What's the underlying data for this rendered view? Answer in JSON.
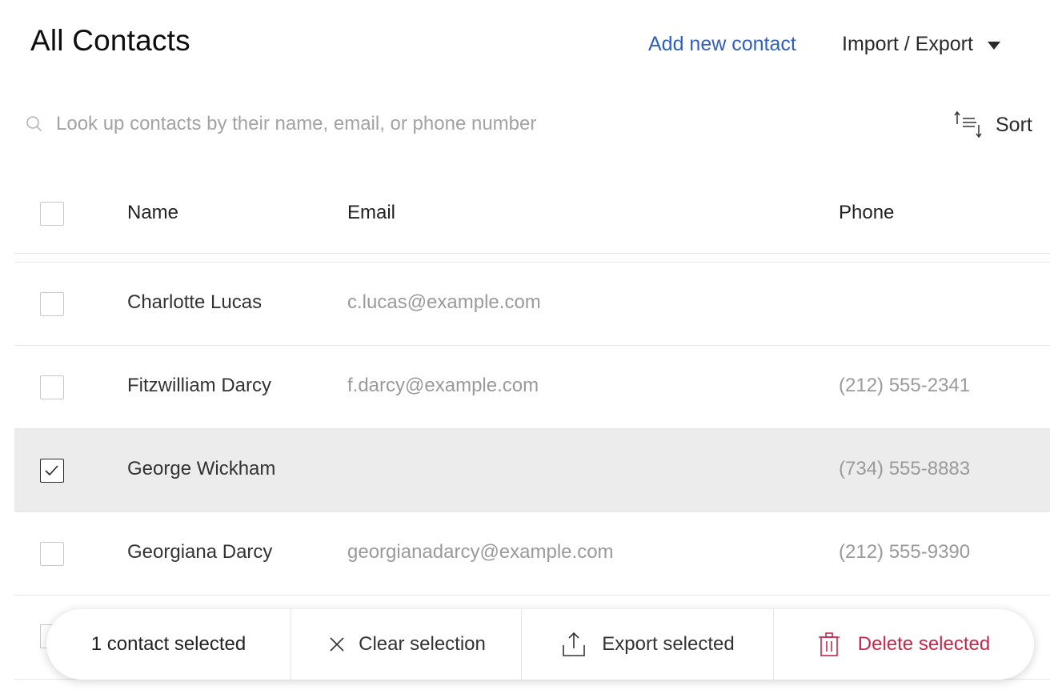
{
  "header": {
    "title": "All Contacts",
    "add_contact_label": "Add new contact",
    "import_export_label": "Import / Export"
  },
  "search": {
    "placeholder": "Look up contacts by their name, email, or phone number",
    "value": ""
  },
  "sort": {
    "label": "Sort"
  },
  "table": {
    "columns": [
      "Name",
      "Email",
      "Phone"
    ],
    "rows": [
      {
        "name": "Charlotte Lucas",
        "email": "c.lucas@example.com",
        "phone": "",
        "selected": false
      },
      {
        "name": "Fitzwilliam Darcy",
        "email": "f.darcy@example.com",
        "phone": "(212) 555-2341",
        "selected": false
      },
      {
        "name": "George Wickham",
        "email": "",
        "phone": "(734) 555-8883",
        "selected": true
      },
      {
        "name": "Georgiana Darcy",
        "email": "georgianadarcy@example.com",
        "phone": "(212) 555-9390",
        "selected": false
      }
    ]
  },
  "selection_bar": {
    "count_label": "1 contact selected",
    "clear_label": "Clear selection",
    "export_label": "Export selected",
    "delete_label": "Delete selected"
  },
  "icons": {
    "search": "search-icon",
    "sort": "sort-icon",
    "caret": "caret-down-icon",
    "clear": "close-icon",
    "export": "upload-icon",
    "delete": "trash-icon",
    "check": "checkmark-icon"
  },
  "colors": {
    "link": "#2f5fbf",
    "danger": "#c8274b",
    "selected_row": "#ececec"
  }
}
